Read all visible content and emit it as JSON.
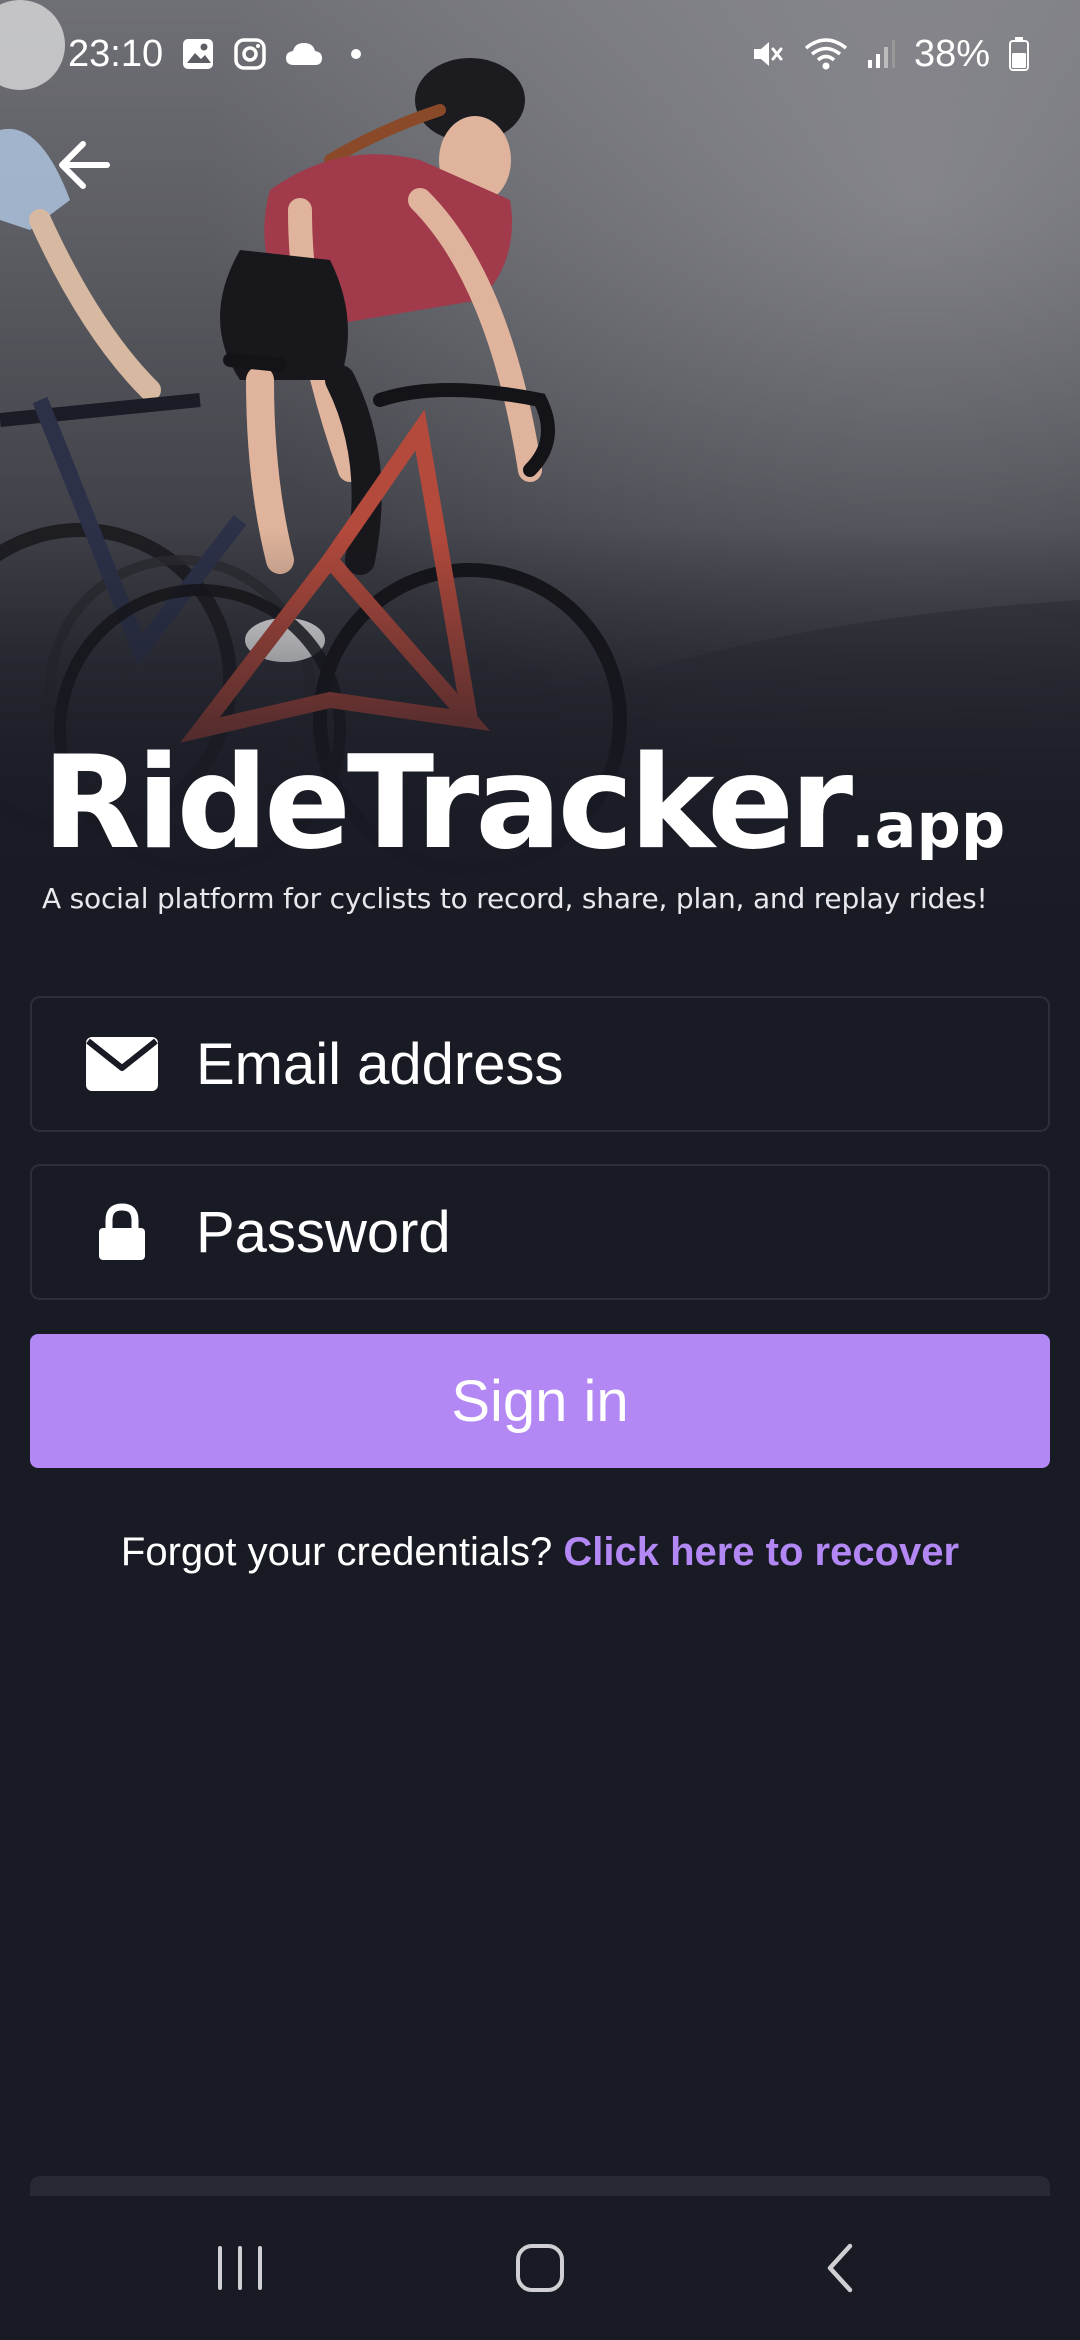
{
  "status_bar": {
    "time": "23:10",
    "battery_percent": "38%",
    "left_icons": [
      "gallery-icon",
      "instagram-icon",
      "cloud-icon",
      "dot-icon"
    ],
    "right_icons": [
      "mute-icon",
      "wifi-icon",
      "signal-icon",
      "battery-icon"
    ]
  },
  "header": {
    "back_icon": "arrow-left-icon"
  },
  "brand": {
    "name": "RideTracker",
    "suffix": ".app",
    "tagline": "A social platform for cyclists to record, share, plan, and replay rides!"
  },
  "form": {
    "email": {
      "placeholder": "Email address",
      "value": "",
      "icon": "envelope-icon"
    },
    "password": {
      "placeholder": "Password",
      "value": "",
      "icon": "lock-icon"
    },
    "submit_label": "Sign in",
    "forgot_prefix": "Forgot your credentials?",
    "forgot_link": "Click here to recover"
  },
  "colors": {
    "background": "#181a24",
    "accent": "#b388f5",
    "field_border": "#2c2f3b",
    "text": "#ffffff"
  },
  "nav_bar": {
    "buttons": [
      "recents-icon",
      "home-icon",
      "back-icon"
    ]
  }
}
